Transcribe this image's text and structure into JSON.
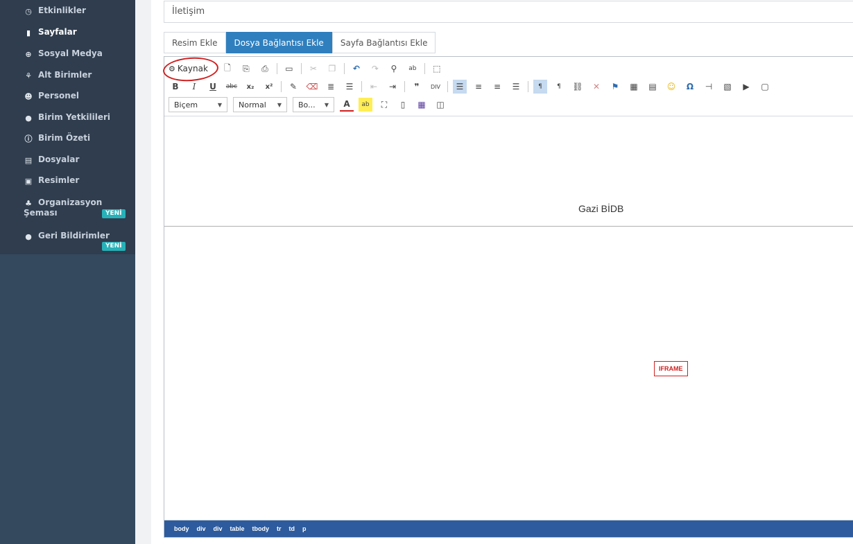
{
  "sidebar": {
    "items": [
      {
        "label": "Etkinlikler",
        "icon": "clock-icon"
      },
      {
        "label": "Sayfalar",
        "icon": "file-icon"
      },
      {
        "label": "Sosyal Medya",
        "icon": "globe-icon"
      },
      {
        "label": "Alt Birimler",
        "icon": "sitemap-icon"
      },
      {
        "label": "Personel",
        "icon": "users-icon"
      },
      {
        "label": "Birim Yetkilileri",
        "icon": "user-icon"
      },
      {
        "label": "Birim Özeti",
        "icon": "info-icon"
      },
      {
        "label": "Dosyalar",
        "icon": "briefcase-icon"
      },
      {
        "label": "Resimler",
        "icon": "image-icon"
      },
      {
        "label_line1": "Organizasyon",
        "label_line2": "Şeması",
        "badge": "YENİ",
        "icon": "org-chart-icon"
      },
      {
        "label": "Geri Bildirimler",
        "badge": "YENİ",
        "icon": "comment-icon"
      }
    ]
  },
  "page": {
    "title_value": "İletişim"
  },
  "tabs": [
    {
      "label": "Resim Ekle"
    },
    {
      "label": "Dosya Bağlantısı Ekle"
    },
    {
      "label": "Sayfa Bağlantısı Ekle"
    }
  ],
  "editor": {
    "source_label": "Kaynak",
    "style_combo": "Biçem",
    "format_combo": "Normal",
    "size_combo": "Bo...",
    "content_text": "Gazi BİDB",
    "iframe_label": "IFRAME",
    "path": [
      "body",
      "div",
      "div",
      "table",
      "tbody",
      "tr",
      "td",
      "p"
    ]
  },
  "colors": {
    "sidebar_bg": "#2f3d4e",
    "accent": "#2f7fbe",
    "badge": "#27b1b8",
    "pathbar": "#2d5b9d",
    "annotation": "#d02020"
  }
}
